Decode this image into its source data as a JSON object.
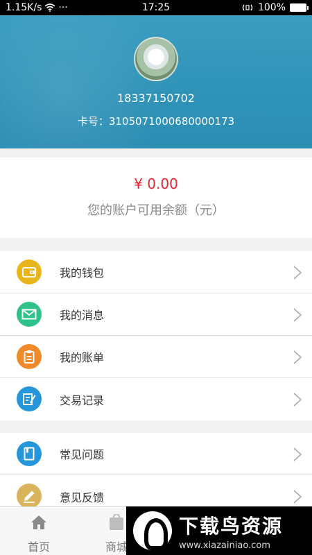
{
  "status_bar": {
    "network_speed": "1.15K/s",
    "more": "···",
    "time": "17:25",
    "battery": "100%",
    "battery_level": 1.0
  },
  "profile": {
    "phone": "18337150702",
    "card_label": "卡号：",
    "card_number": "3105071000680000173"
  },
  "balance": {
    "amount": "¥ 0.00",
    "label": "您的账户可用余额（元）"
  },
  "menu_group_1": [
    {
      "label": "我的钱包",
      "icon": "wallet-icon",
      "color": "#e8b51b"
    },
    {
      "label": "我的消息",
      "icon": "envelope-icon",
      "color": "#2ec28a"
    },
    {
      "label": "我的账单",
      "icon": "clipboard-icon",
      "color": "#ef8a2b"
    },
    {
      "label": "交易记录",
      "icon": "edit-record-icon",
      "color": "#2496d9"
    }
  ],
  "menu_group_2": [
    {
      "label": "常见问题",
      "icon": "book-icon",
      "color": "#2496d9"
    },
    {
      "label": "意见反馈",
      "icon": "pencil-icon",
      "color": "#d9b45c"
    }
  ],
  "tabbar": {
    "home": "首页",
    "mall": "商城"
  },
  "watermark": {
    "title": "下载鸟资源",
    "url": "www.xiazainiao.com"
  },
  "colors": {
    "header": "#3297bc",
    "amount": "#e8232d",
    "background": "#f2f2f2"
  }
}
